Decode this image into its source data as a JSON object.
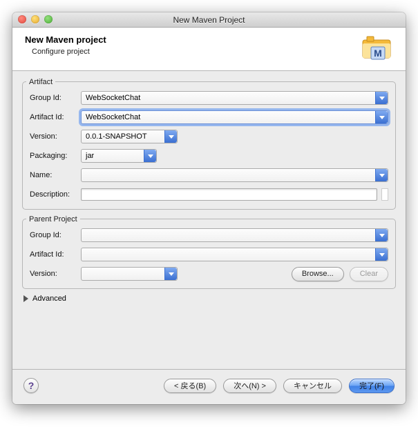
{
  "window": {
    "title": "New Maven Project"
  },
  "header": {
    "title": "New Maven project",
    "subtitle": "Configure project"
  },
  "artifact": {
    "legend": "Artifact",
    "labels": {
      "group_id": "Group Id:",
      "artifact_id": "Artifact Id:",
      "version": "Version:",
      "packaging": "Packaging:",
      "name": "Name:",
      "description": "Description:"
    },
    "group_id": "WebSocketChat",
    "artifact_id": "WebSocketChat",
    "version": "0.0.1-SNAPSHOT",
    "packaging": "jar",
    "name": "",
    "description": ""
  },
  "parent": {
    "legend": "Parent Project",
    "labels": {
      "group_id": "Group Id:",
      "artifact_id": "Artifact Id:",
      "version": "Version:"
    },
    "group_id": "",
    "artifact_id": "",
    "version": "",
    "browse": "Browse...",
    "clear": "Clear"
  },
  "advanced": {
    "label": "Advanced"
  },
  "footer": {
    "back": "< 戻る(B)",
    "next": "次へ(N) >",
    "cancel": "キャンセル",
    "finish": "完了(F)"
  }
}
